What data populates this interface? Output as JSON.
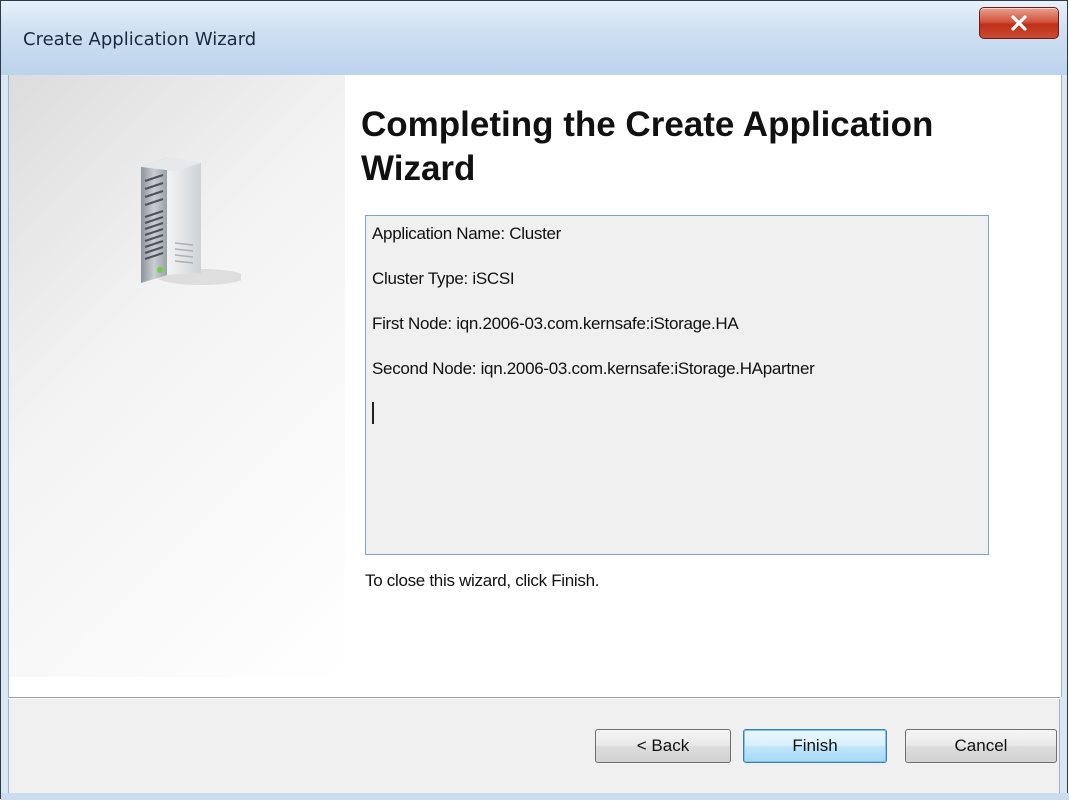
{
  "window": {
    "title": "Create Application Wizard",
    "close_label": "x"
  },
  "main": {
    "heading": "Completing the Create Application Wizard",
    "summary_lines": [
      "Application Name: Cluster",
      "Cluster Type: iSCSI",
      "First Node: iqn.2006-03.com.kernsafe:iStorage.HA",
      "Second Node: iqn.2006-03.com.kernsafe:iStorage.HApartner"
    ],
    "finish_note": "To close this wizard, click Finish."
  },
  "footer": {
    "back_label": "< Back",
    "finish_label": "Finish",
    "cancel_label": "Cancel"
  },
  "icons": {
    "close": "close-icon",
    "server": "server-icon"
  },
  "colors": {
    "close_button": "#c94b33",
    "default_button": "#bee6fd",
    "summary_border": "#7fa4c8"
  }
}
